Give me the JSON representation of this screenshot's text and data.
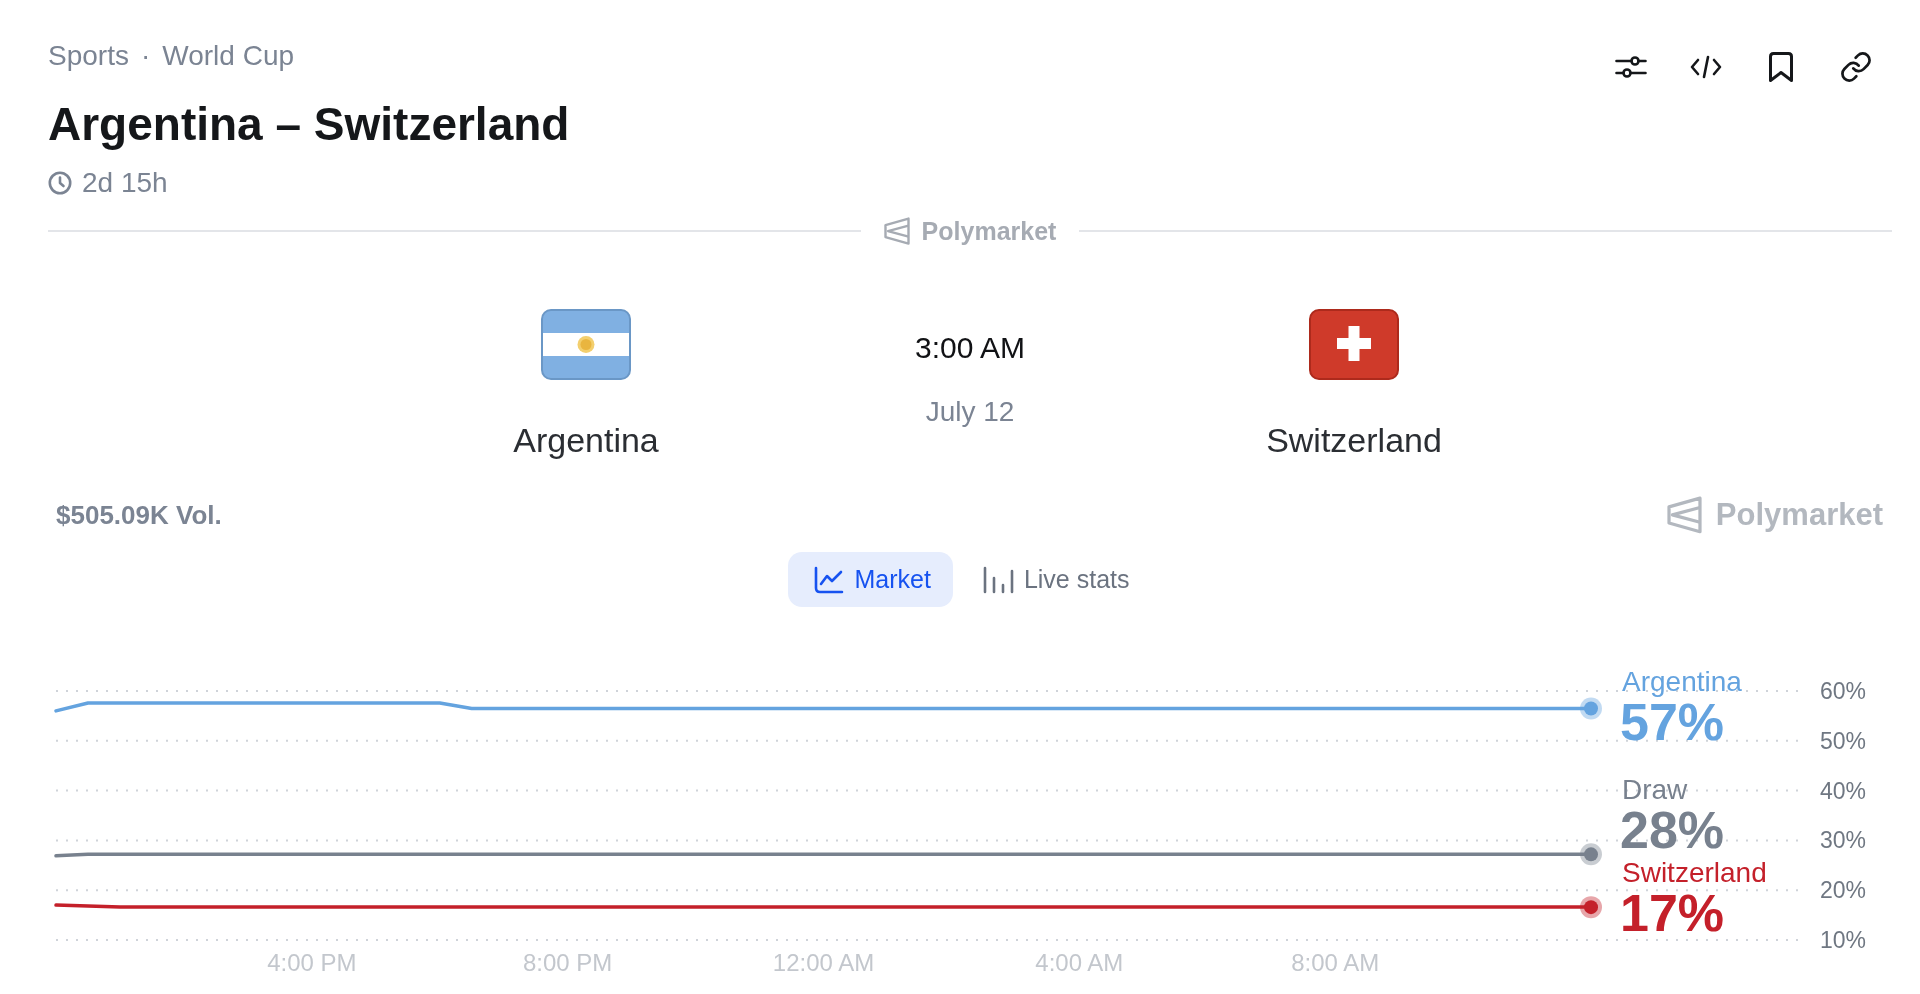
{
  "breadcrumb": {
    "items": [
      "Sports",
      "World Cup"
    ],
    "separator": "·"
  },
  "title": "Argentina – Switzerland",
  "countdown": "2d 15h",
  "toolbar": [
    {
      "kind": "sliders"
    },
    {
      "kind": "code"
    },
    {
      "kind": "bookmark"
    },
    {
      "kind": "link"
    }
  ],
  "source": "Polymarket",
  "match": {
    "teams": [
      {
        "name": "Argentina",
        "kind": "argentina"
      },
      {
        "name": "Switzerland",
        "kind": "switzerland"
      }
    ],
    "time": "3:00 AM",
    "date": "July 12"
  },
  "market": {
    "volume": "$505.09K Vol.",
    "brand": "Polymarket"
  },
  "tabs": [
    {
      "label": "Market",
      "kind": "line",
      "selected": true
    },
    {
      "label": "Live stats",
      "kind": "bars",
      "selected": false
    }
  ],
  "chart": {
    "chart_data": {
      "type": "line",
      "grid": true,
      "categories": [
        null,
        null,
        null,
        null,
        null,
        null,
        null,
        null,
        "4:00 PM",
        null,
        null,
        null,
        null,
        null,
        null,
        null,
        "8:00 PM",
        null,
        null,
        null,
        null,
        null,
        null,
        null,
        "12:00 AM",
        null,
        null,
        null,
        null,
        null,
        null,
        null,
        "4:00 AM",
        null,
        null,
        null,
        null,
        null,
        null,
        null,
        "8:00 AM",
        null,
        null,
        null,
        null,
        null,
        null,
        null,
        null
      ],
      "series": [
        {
          "name": "Argentina",
          "color": "#64a3df",
          "values": [
            56.0,
            57.6,
            57.6,
            57.6,
            57.6,
            57.6,
            57.6,
            57.6,
            57.6,
            57.6,
            57.6,
            57.6,
            57.6,
            56.5,
            56.5,
            56.5,
            56.5,
            56.5,
            56.5,
            56.5,
            56.5,
            56.5,
            56.5,
            56.5,
            56.5,
            56.5,
            56.5,
            56.5,
            56.5,
            56.5,
            56.5,
            56.5,
            56.5,
            56.5,
            56.5,
            56.5,
            56.5,
            56.5,
            56.5,
            56.5,
            56.5,
            56.5,
            56.5,
            56.5,
            56.5,
            56.5,
            56.5,
            56.5,
            56.5
          ]
        },
        {
          "name": "Draw",
          "color": "#78818e",
          "values": [
            26.9,
            27.2,
            27.2,
            27.2,
            27.2,
            27.2,
            27.2,
            27.2,
            27.2,
            27.2,
            27.2,
            27.2,
            27.2,
            27.2,
            27.2,
            27.2,
            27.2,
            27.2,
            27.2,
            27.2,
            27.2,
            27.2,
            27.2,
            27.2,
            27.2,
            27.2,
            27.2,
            27.2,
            27.2,
            27.2,
            27.2,
            27.2,
            27.2,
            27.2,
            27.2,
            27.2,
            27.2,
            27.2,
            27.2,
            27.2,
            27.2,
            27.2,
            27.2,
            27.2,
            27.2,
            27.2,
            27.2,
            27.2,
            27.2
          ]
        },
        {
          "name": "Switzerland",
          "color": "#c4202a",
          "values": [
            17.0,
            16.8,
            16.6,
            16.6,
            16.6,
            16.6,
            16.6,
            16.6,
            16.6,
            16.6,
            16.6,
            16.6,
            16.6,
            16.6,
            16.6,
            16.6,
            16.6,
            16.6,
            16.6,
            16.6,
            16.6,
            16.6,
            16.6,
            16.6,
            16.6,
            16.6,
            16.6,
            16.6,
            16.6,
            16.6,
            16.6,
            16.6,
            16.6,
            16.6,
            16.6,
            16.6,
            16.6,
            16.6,
            16.6,
            16.6,
            16.6,
            16.6,
            16.6,
            16.6,
            16.6,
            16.6,
            16.6,
            16.6,
            16.6
          ]
        }
      ],
      "ylim": [
        10,
        60
      ],
      "yticks": [
        {
          "value": 10,
          "label": "10%"
        },
        {
          "value": 20,
          "label": "20%"
        },
        {
          "value": 30,
          "label": "30%"
        },
        {
          "value": 40,
          "label": "40%"
        },
        {
          "value": 50,
          "label": "50%"
        },
        {
          "value": 60,
          "label": "60%"
        }
      ],
      "value_labels": [
        [
          null,
          null,
          null,
          null,
          null,
          null,
          null,
          null,
          null,
          null,
          null,
          null,
          null,
          null,
          null,
          null,
          null,
          null,
          null,
          null,
          null,
          null,
          null,
          null,
          null,
          null,
          null,
          null,
          null,
          null,
          null,
          null,
          null,
          null,
          null,
          null,
          null,
          null,
          null,
          null,
          null,
          null,
          null,
          null,
          null,
          null,
          null,
          null,
          "57%"
        ],
        [
          null,
          null,
          null,
          null,
          null,
          null,
          null,
          null,
          null,
          null,
          null,
          null,
          null,
          null,
          null,
          null,
          null,
          null,
          null,
          null,
          null,
          null,
          null,
          null,
          null,
          null,
          null,
          null,
          null,
          null,
          null,
          null,
          null,
          null,
          null,
          null,
          null,
          null,
          null,
          null,
          null,
          null,
          null,
          null,
          null,
          null,
          null,
          null,
          "28%"
        ],
        [
          null,
          null,
          null,
          null,
          null,
          null,
          null,
          null,
          null,
          null,
          null,
          null,
          null,
          null,
          null,
          null,
          null,
          null,
          null,
          null,
          null,
          null,
          null,
          null,
          null,
          null,
          null,
          null,
          null,
          null,
          null,
          null,
          null,
          null,
          null,
          null,
          null,
          null,
          null,
          null,
          null,
          null,
          null,
          null,
          null,
          null,
          null,
          null,
          "17%"
        ]
      ]
    }
  }
}
